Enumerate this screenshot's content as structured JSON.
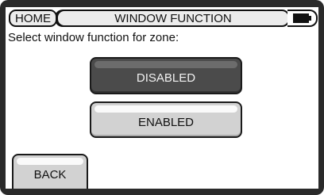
{
  "header": {
    "home_label": "HOME",
    "title": "WINDOW FUNCTION",
    "battery_icon": "battery-icon"
  },
  "prompt": "Select window function for zone:",
  "options": {
    "disabled_label": "DISABLED",
    "enabled_label": "ENABLED",
    "selected": "DISABLED"
  },
  "footer": {
    "back_label": "BACK"
  },
  "colors": {
    "selected_button": "#4b4b4b",
    "unselected_button": "#d2d2d2",
    "bezel": "#2a2a2a"
  }
}
